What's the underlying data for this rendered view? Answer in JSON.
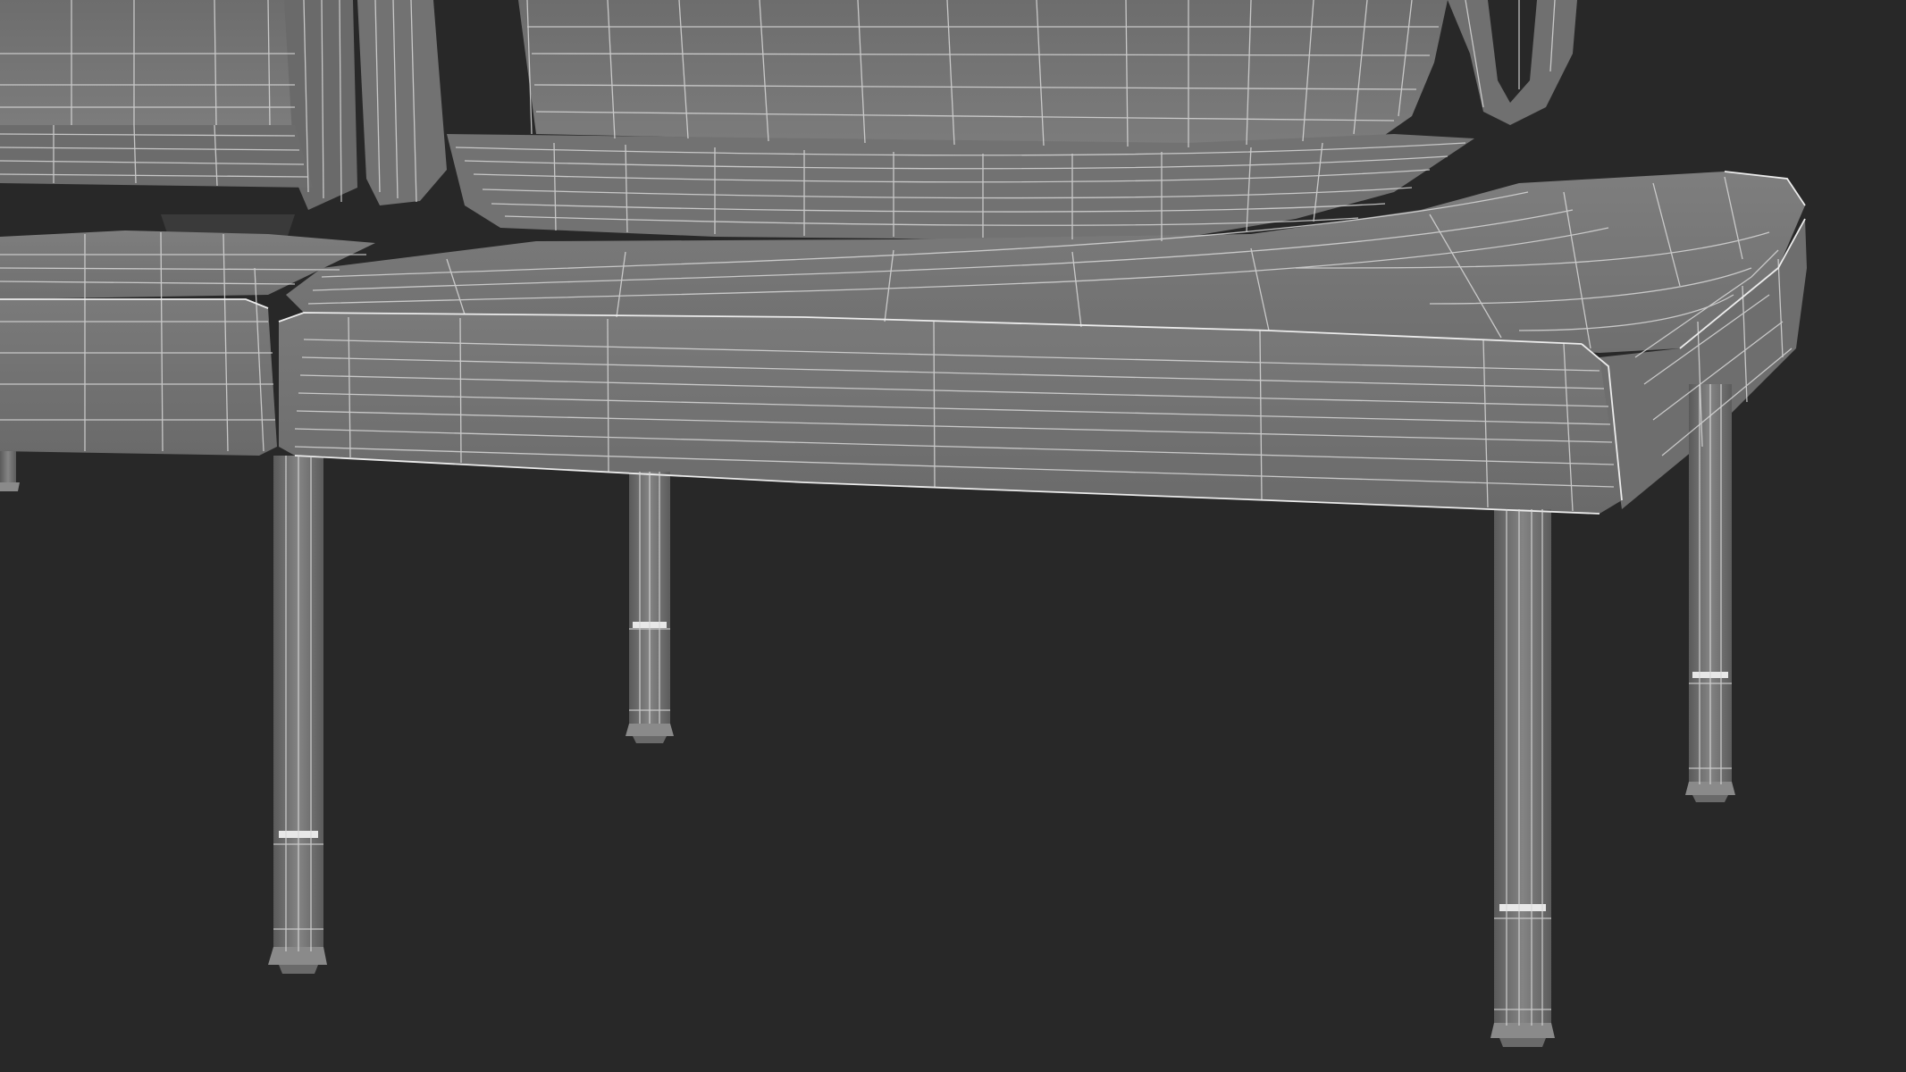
{
  "scene": {
    "subject": "wireframe-render-bench",
    "background_color": "#282828",
    "surface_color": "#767676",
    "surface_dark_color": "#5e5e5e",
    "surface_light_color": "#8a8a8a",
    "wire_color": "#d8d8d8"
  }
}
